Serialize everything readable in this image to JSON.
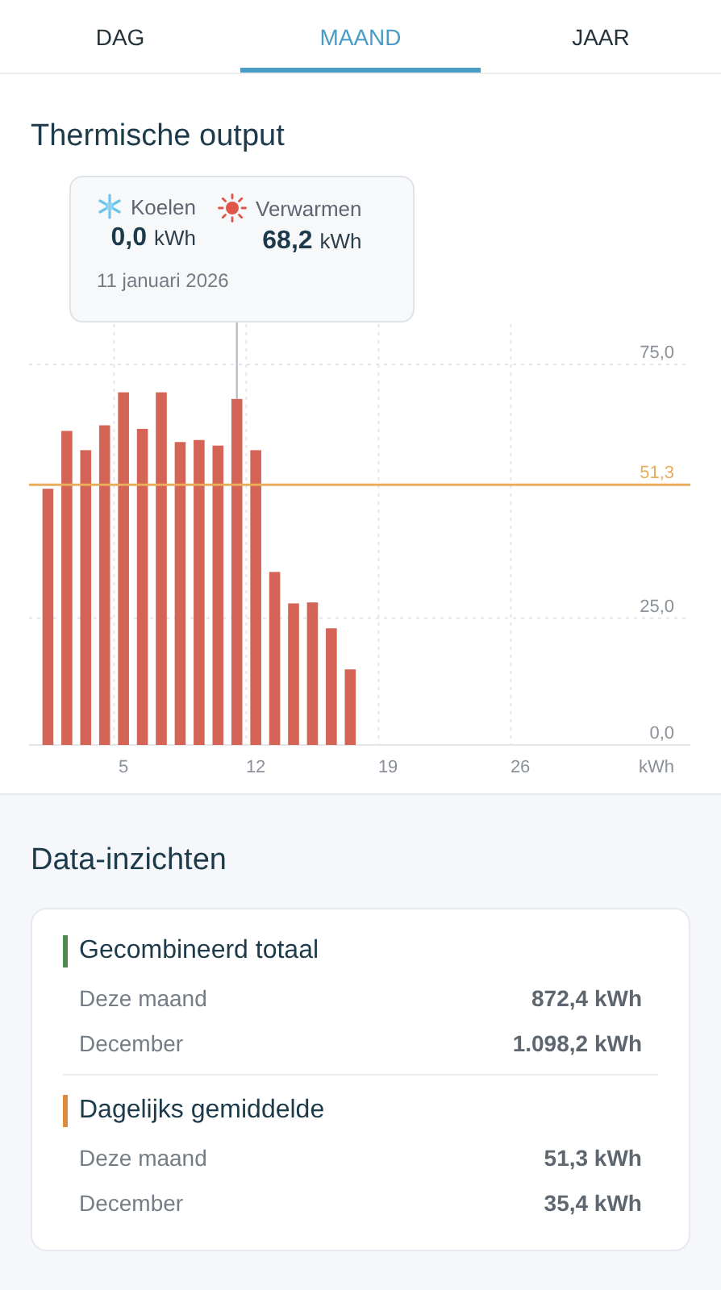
{
  "tabs": [
    {
      "label": "DAG",
      "selected": false
    },
    {
      "label": "MAAND",
      "selected": true
    },
    {
      "label": "JAAR",
      "selected": false
    }
  ],
  "output": {
    "title": "Thermische output",
    "tooltip": {
      "items": [
        {
          "kind": "cooling",
          "label": "Koelen",
          "value": "0,0",
          "unit": "kWh"
        },
        {
          "kind": "heating",
          "label": "Verwarmen",
          "value": "68,2",
          "unit": "kWh"
        }
      ],
      "date": "11 januari 2026"
    },
    "chart_data": {
      "type": "bar",
      "xlabel": "kWh",
      "x": [
        1,
        2,
        3,
        4,
        5,
        6,
        7,
        8,
        9,
        10,
        11,
        12,
        13,
        14,
        15,
        16,
        17
      ],
      "series": [
        {
          "color": "#d46456",
          "values": [
            50.5,
            61.9,
            58.1,
            63.0,
            69.5,
            62.3,
            69.5,
            59.7,
            60.1,
            59.0,
            68.2,
            58.1,
            34.1,
            27.9,
            28.1,
            23.0,
            14.9
          ]
        }
      ],
      "xlim": [
        0,
        35
      ],
      "ylim": [
        0,
        75
      ],
      "xticks": [
        5,
        12,
        19,
        26
      ],
      "yticks": [
        {
          "value": 0,
          "label": "0,0"
        },
        {
          "value": 25,
          "label": "25,0"
        },
        {
          "value": 75,
          "label": "75,0"
        }
      ],
      "ref_lines": [
        {
          "axis": "y",
          "value": 51.3,
          "label": "51,3",
          "color": "#e9ad5b"
        },
        {
          "axis": "x",
          "value": 11,
          "color": "#b9bfc6"
        }
      ]
    }
  },
  "insights": {
    "title": "Data-inzichten",
    "groups": [
      {
        "title": "Gecombineerd totaal",
        "color": "#4e8a4f",
        "rows": [
          {
            "label": "Deze maand",
            "value": "872,4 kWh"
          },
          {
            "label": "December",
            "value": "1.098,2 kWh"
          }
        ]
      },
      {
        "title": "Dagelijks gemiddelde",
        "color": "#e08a3c",
        "rows": [
          {
            "label": "Deze maand",
            "value": "51,3 kWh"
          },
          {
            "label": "December",
            "value": "35,4 kWh"
          }
        ]
      }
    ]
  }
}
